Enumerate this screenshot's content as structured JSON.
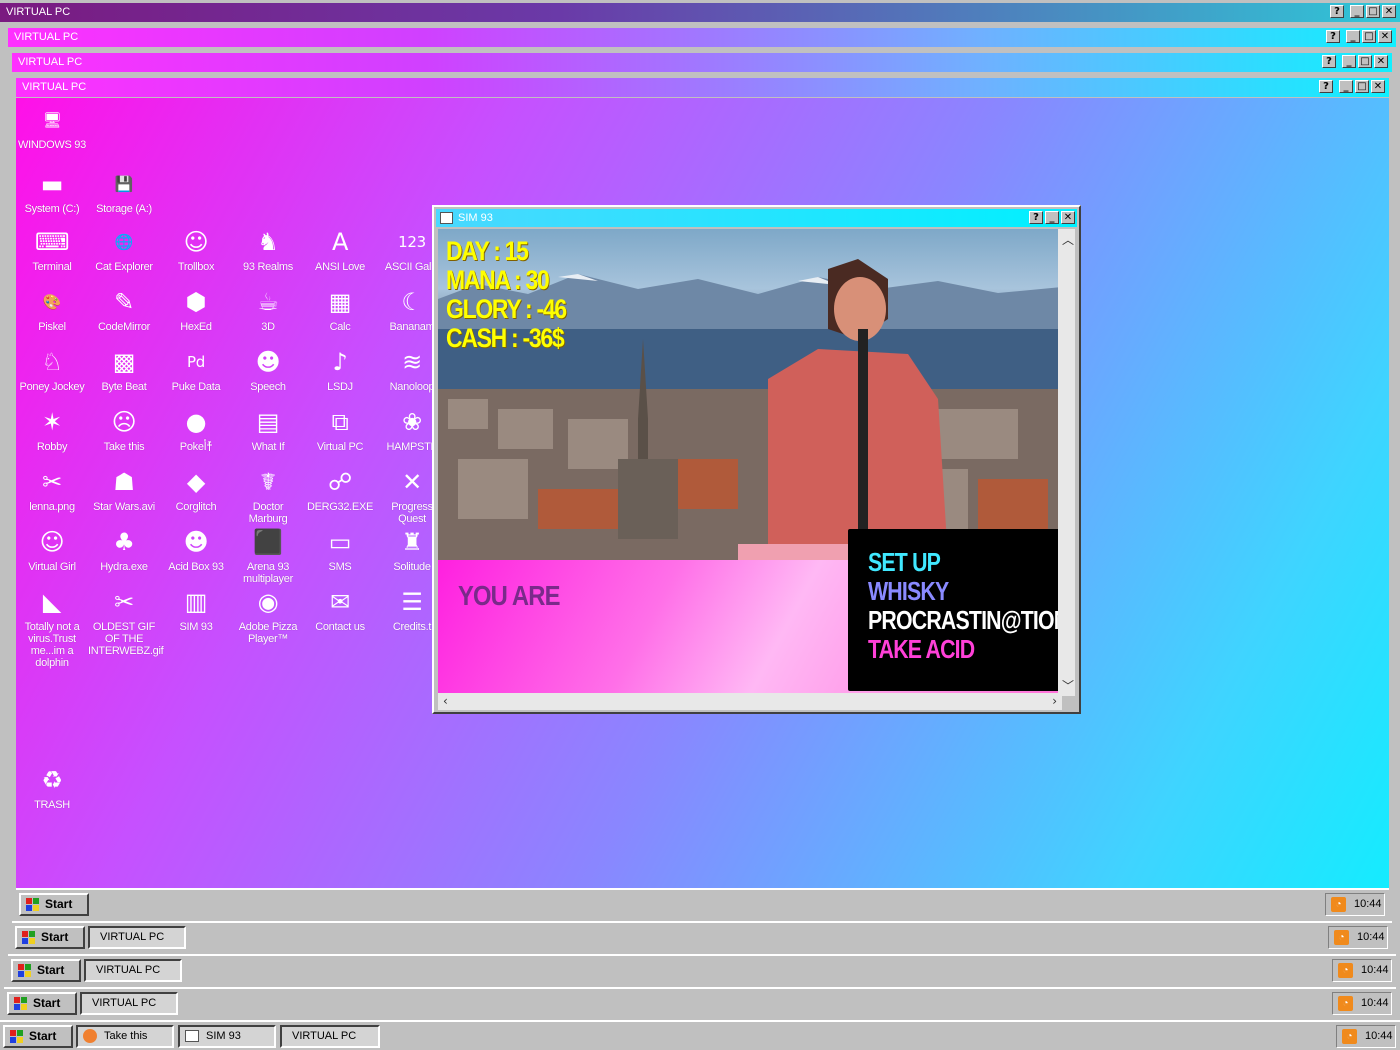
{
  "windows": {
    "title_1": "VIRTUAL PC",
    "title_2": "VIRTUAL PC",
    "title_3": "VIRTUAL PC",
    "title_4": "VIRTUAL PC",
    "help_glyph": "?",
    "minimize_glyph": "_",
    "maximize_glyph": "□",
    "close_glyph": "✕"
  },
  "desktop": {
    "icons": [
      {
        "label": "WINDOWS 93",
        "glyph": "🖥"
      },
      {
        "label": "System (C:)",
        "glyph": "▬"
      },
      {
        "label": "Storage (A:)",
        "glyph": "💾"
      },
      {
        "label": "Terminal",
        "glyph": "⌨"
      },
      {
        "label": "Cat Explorer",
        "glyph": "🌐"
      },
      {
        "label": "Trollbox",
        "glyph": "☺"
      },
      {
        "label": "93 Realms",
        "glyph": "♞"
      },
      {
        "label": "ANSI Love",
        "glyph": "A"
      },
      {
        "label": "ASCII Galle",
        "glyph": "123"
      },
      {
        "label": "Piskel",
        "glyph": "🎨"
      },
      {
        "label": "CodeMirror",
        "glyph": "✎"
      },
      {
        "label": "HexEd",
        "glyph": "⬢"
      },
      {
        "label": "3D",
        "glyph": "☕"
      },
      {
        "label": "Calc",
        "glyph": "▦"
      },
      {
        "label": "Bananam",
        "glyph": "☾"
      },
      {
        "label": "Poney Jockey",
        "glyph": "♘"
      },
      {
        "label": "Byte Beat",
        "glyph": "▩"
      },
      {
        "label": "Puke Data",
        "glyph": "Pd"
      },
      {
        "label": "Speech",
        "glyph": "☻"
      },
      {
        "label": "LSDJ",
        "glyph": "♪"
      },
      {
        "label": "Nanoloop",
        "glyph": "≋"
      },
      {
        "label": "Robby",
        "glyph": "✶"
      },
      {
        "label": "Take this",
        "glyph": "☹"
      },
      {
        "label": "Pokeأ†ً",
        "glyph": "●"
      },
      {
        "label": "What If",
        "glyph": "▤"
      },
      {
        "label": "Virtual PC",
        "glyph": "⧉"
      },
      {
        "label": "HAMPSTE",
        "glyph": "❀"
      },
      {
        "label": "lenna.png",
        "glyph": "✂"
      },
      {
        "label": "Star Wars.avi",
        "glyph": "☗"
      },
      {
        "label": "Corglitch",
        "glyph": "◆"
      },
      {
        "label": "Doctor Marburg",
        "glyph": "☤"
      },
      {
        "label": "DERG32.EXE",
        "glyph": "☍"
      },
      {
        "label": "Progress Quest",
        "glyph": "✕"
      },
      {
        "label": "Virtual Girl",
        "glyph": "☺"
      },
      {
        "label": "Hydra.exe",
        "glyph": "♣"
      },
      {
        "label": "Acid Box 93",
        "glyph": "☻"
      },
      {
        "label": "Arena 93 multiplayer",
        "glyph": "⬛"
      },
      {
        "label": "SMS",
        "glyph": "▭"
      },
      {
        "label": "Solitude",
        "glyph": "♜"
      },
      {
        "label": "Totally not a virus.Trust me...im a dolphin",
        "glyph": "◣"
      },
      {
        "label": "OLDEST GIF OF THE INTERWEBZ.gif",
        "glyph": "✂"
      },
      {
        "label": "SIM 93",
        "glyph": "▥"
      },
      {
        "label": "Adobe Pizza Player™",
        "glyph": "◉"
      },
      {
        "label": "Contact us",
        "glyph": "✉"
      },
      {
        "label": "Credits.t",
        "glyph": "☰"
      },
      {
        "label": "TRASH",
        "glyph": "♻"
      }
    ]
  },
  "sim": {
    "title": "SIM 93",
    "stats": {
      "day": "DAY : 15",
      "mana": "MANA : 30",
      "glory": "GLORY : -46",
      "cash": "CASH : -36$"
    },
    "you_are": "YOU ARE",
    "choices": [
      "SET UP",
      "WHISKY",
      "PROCRASTIN@TION",
      "TAKE ACID"
    ],
    "choice_colors": [
      "#40e8ff",
      "#8a8aff",
      "#ffffff",
      "#ff40d8"
    ]
  },
  "taskbars": {
    "start_label": "Start",
    "virtual_pc_item": "VIRTUAL PC",
    "take_this_item": "Take this",
    "sim_item": "SIM 93",
    "clock": "10:44"
  }
}
